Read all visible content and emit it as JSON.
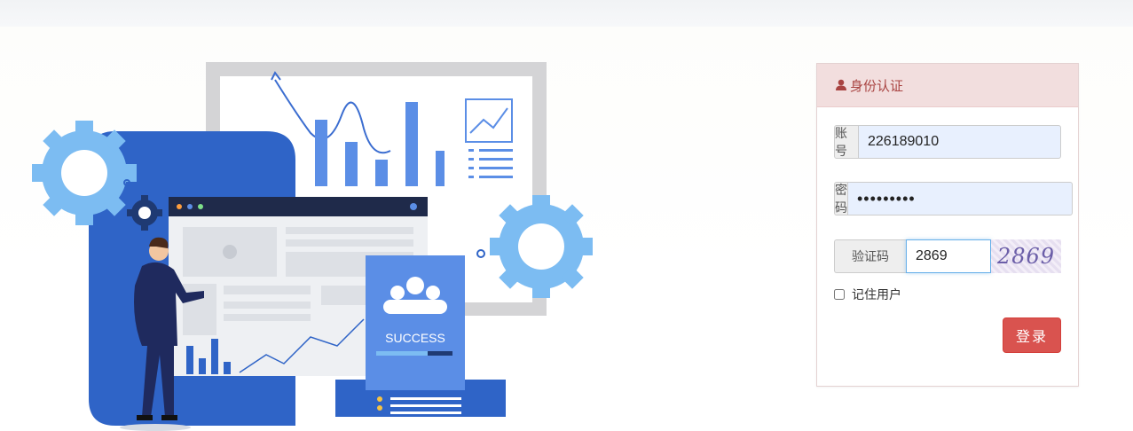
{
  "login": {
    "panel_title": "身份认证",
    "account_label": "账 号",
    "account_value": "226189010",
    "password_label": "密 码",
    "password_value": "•••••••••",
    "captcha_label": "验证码",
    "captcha_value": "2869",
    "captcha_image_text": "2869",
    "remember_label": "记住用户",
    "submit_label": "登录"
  },
  "illustration": {
    "badge_text": "SUCCESS"
  },
  "colors": {
    "panel_header_bg": "#f2dede",
    "panel_header_text": "#a94442",
    "login_button": "#d9534f",
    "gear_blue": "#7cbcf2",
    "deep_blue": "#2f64c7"
  }
}
